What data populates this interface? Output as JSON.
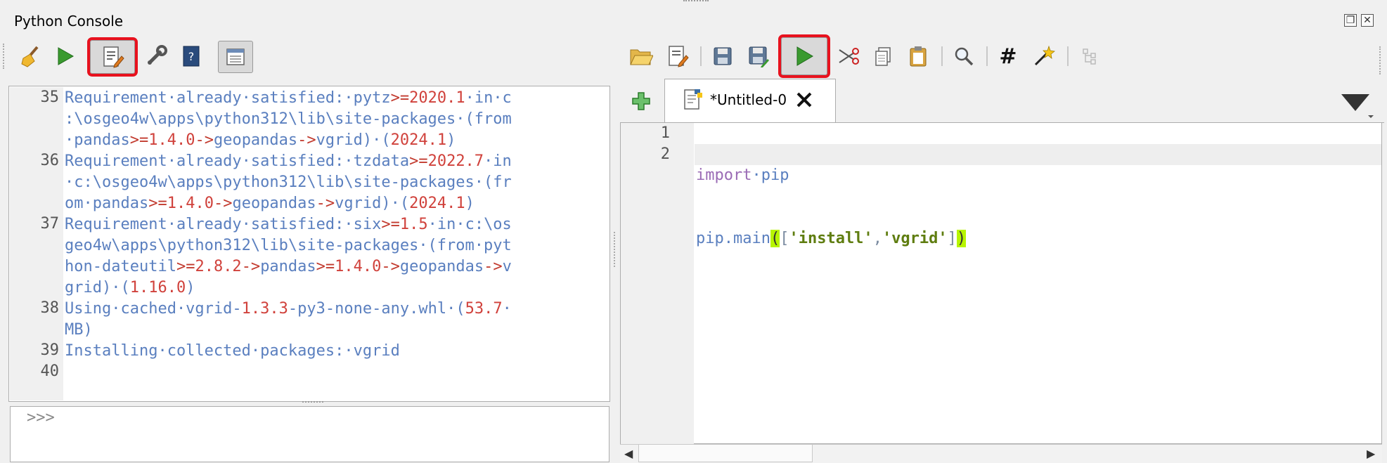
{
  "panel_title": "Python Console",
  "window_controls": {
    "float_icon": "float-icon",
    "close_icon": "close-icon"
  },
  "console_toolbar": [
    {
      "name": "clear-console-button",
      "icon": "broom-icon"
    },
    {
      "name": "run-command-button",
      "icon": "play-icon"
    },
    {
      "name": "show-editor-button",
      "icon": "editor-icon",
      "highlighted": true
    },
    {
      "name": "options-button",
      "icon": "wrench-icon"
    },
    {
      "name": "help-button",
      "icon": "help-book-icon"
    },
    {
      "name": "object-inspector-button",
      "icon": "window-icon"
    }
  ],
  "editor_toolbar": [
    {
      "name": "open-script-button",
      "icon": "folder-open-icon"
    },
    {
      "name": "open-in-external-editor-button",
      "icon": "edit-file-icon"
    },
    {
      "name": "save-button",
      "icon": "save-icon"
    },
    {
      "name": "save-as-button",
      "icon": "save-as-icon"
    },
    {
      "name": "run-script-button",
      "icon": "play-icon",
      "highlighted": true
    },
    {
      "name": "cut-button",
      "icon": "scissors-icon"
    },
    {
      "name": "copy-button",
      "icon": "copy-icon"
    },
    {
      "name": "paste-button",
      "icon": "paste-icon"
    },
    {
      "name": "find-button",
      "icon": "magnifier-icon"
    },
    {
      "name": "comment-button",
      "icon": "hash-icon"
    },
    {
      "name": "reformat-button",
      "icon": "magic-wand-icon"
    },
    {
      "name": "object-inspector-editor-button",
      "icon": "tree-icon"
    }
  ],
  "output": {
    "line_numbers": [
      "35",
      "",
      "",
      "36",
      "",
      "",
      "37",
      "",
      "",
      "",
      "38",
      "",
      "39",
      "40"
    ],
    "lines": [
      [
        [
          "txt",
          "Requirement·already·satisfied:·pytz"
        ],
        [
          "op",
          ">="
        ],
        [
          "num",
          "2020.1"
        ],
        [
          "txt",
          "·in·c"
        ]
      ],
      [
        [
          "txt",
          ":\\osgeo4w\\apps\\python312\\lib\\site-packages·(from"
        ]
      ],
      [
        [
          "txt",
          "·pandas"
        ],
        [
          "op",
          ">="
        ],
        [
          "num",
          "1.4.0"
        ],
        [
          "op",
          "->"
        ],
        [
          "txt",
          "geopandas"
        ],
        [
          "op",
          "->"
        ],
        [
          "txt",
          "vgrid)·("
        ],
        [
          "num",
          "2024.1"
        ],
        [
          "txt",
          ")"
        ]
      ],
      [
        [
          "txt",
          "Requirement·already·satisfied:·tzdata"
        ],
        [
          "op",
          ">="
        ],
        [
          "num",
          "2022.7"
        ],
        [
          "txt",
          "·in"
        ]
      ],
      [
        [
          "txt",
          "·c:\\osgeo4w\\apps\\python312\\lib\\site-packages·(fr"
        ]
      ],
      [
        [
          "txt",
          "om·pandas"
        ],
        [
          "op",
          ">="
        ],
        [
          "num",
          "1.4.0"
        ],
        [
          "op",
          "->"
        ],
        [
          "txt",
          "geopandas"
        ],
        [
          "op",
          "->"
        ],
        [
          "txt",
          "vgrid)·("
        ],
        [
          "num",
          "2024.1"
        ],
        [
          "txt",
          ")"
        ]
      ],
      [
        [
          "txt",
          "Requirement·already·satisfied:·six"
        ],
        [
          "op",
          ">="
        ],
        [
          "num",
          "1.5"
        ],
        [
          "txt",
          "·in·c:\\os"
        ]
      ],
      [
        [
          "txt",
          "geo4w\\apps\\python312\\lib\\site-packages·(from·pyt"
        ]
      ],
      [
        [
          "txt",
          "hon-dateutil"
        ],
        [
          "op",
          ">="
        ],
        [
          "num",
          "2.8.2"
        ],
        [
          "op",
          "->"
        ],
        [
          "txt",
          "pandas"
        ],
        [
          "op",
          ">="
        ],
        [
          "num",
          "1.4.0"
        ],
        [
          "op",
          "->"
        ],
        [
          "txt",
          "geopandas"
        ],
        [
          "op",
          "->"
        ],
        [
          "txt",
          "v"
        ]
      ],
      [
        [
          "txt",
          "grid)·("
        ],
        [
          "num",
          "1.16.0"
        ],
        [
          "txt",
          ")"
        ]
      ],
      [
        [
          "txt",
          "Using·cached·vgrid-"
        ],
        [
          "num",
          "1.3.3"
        ],
        [
          "txt",
          "-py3-none-any.whl·("
        ],
        [
          "num",
          "53.7"
        ],
        [
          "txt",
          "·"
        ]
      ],
      [
        [
          "txt",
          "MB)"
        ]
      ],
      [
        [
          "txt",
          "Installing·collected·packages:·vgrid"
        ]
      ],
      [
        [
          "txt",
          ""
        ]
      ]
    ]
  },
  "prompt": ">>>",
  "editor": {
    "tab_label": "*Untitled-0",
    "line_numbers": [
      "1",
      "2"
    ],
    "code_line1": [
      "import",
      "·pip"
    ],
    "code_line2": {
      "call": "pip.main",
      "open_paren": "(",
      "open_bracket": "[",
      "arg1": "'install'",
      "comma": ",",
      "arg2": "'vgrid'",
      "close_bracket": "]",
      "close_paren": ")"
    }
  }
}
